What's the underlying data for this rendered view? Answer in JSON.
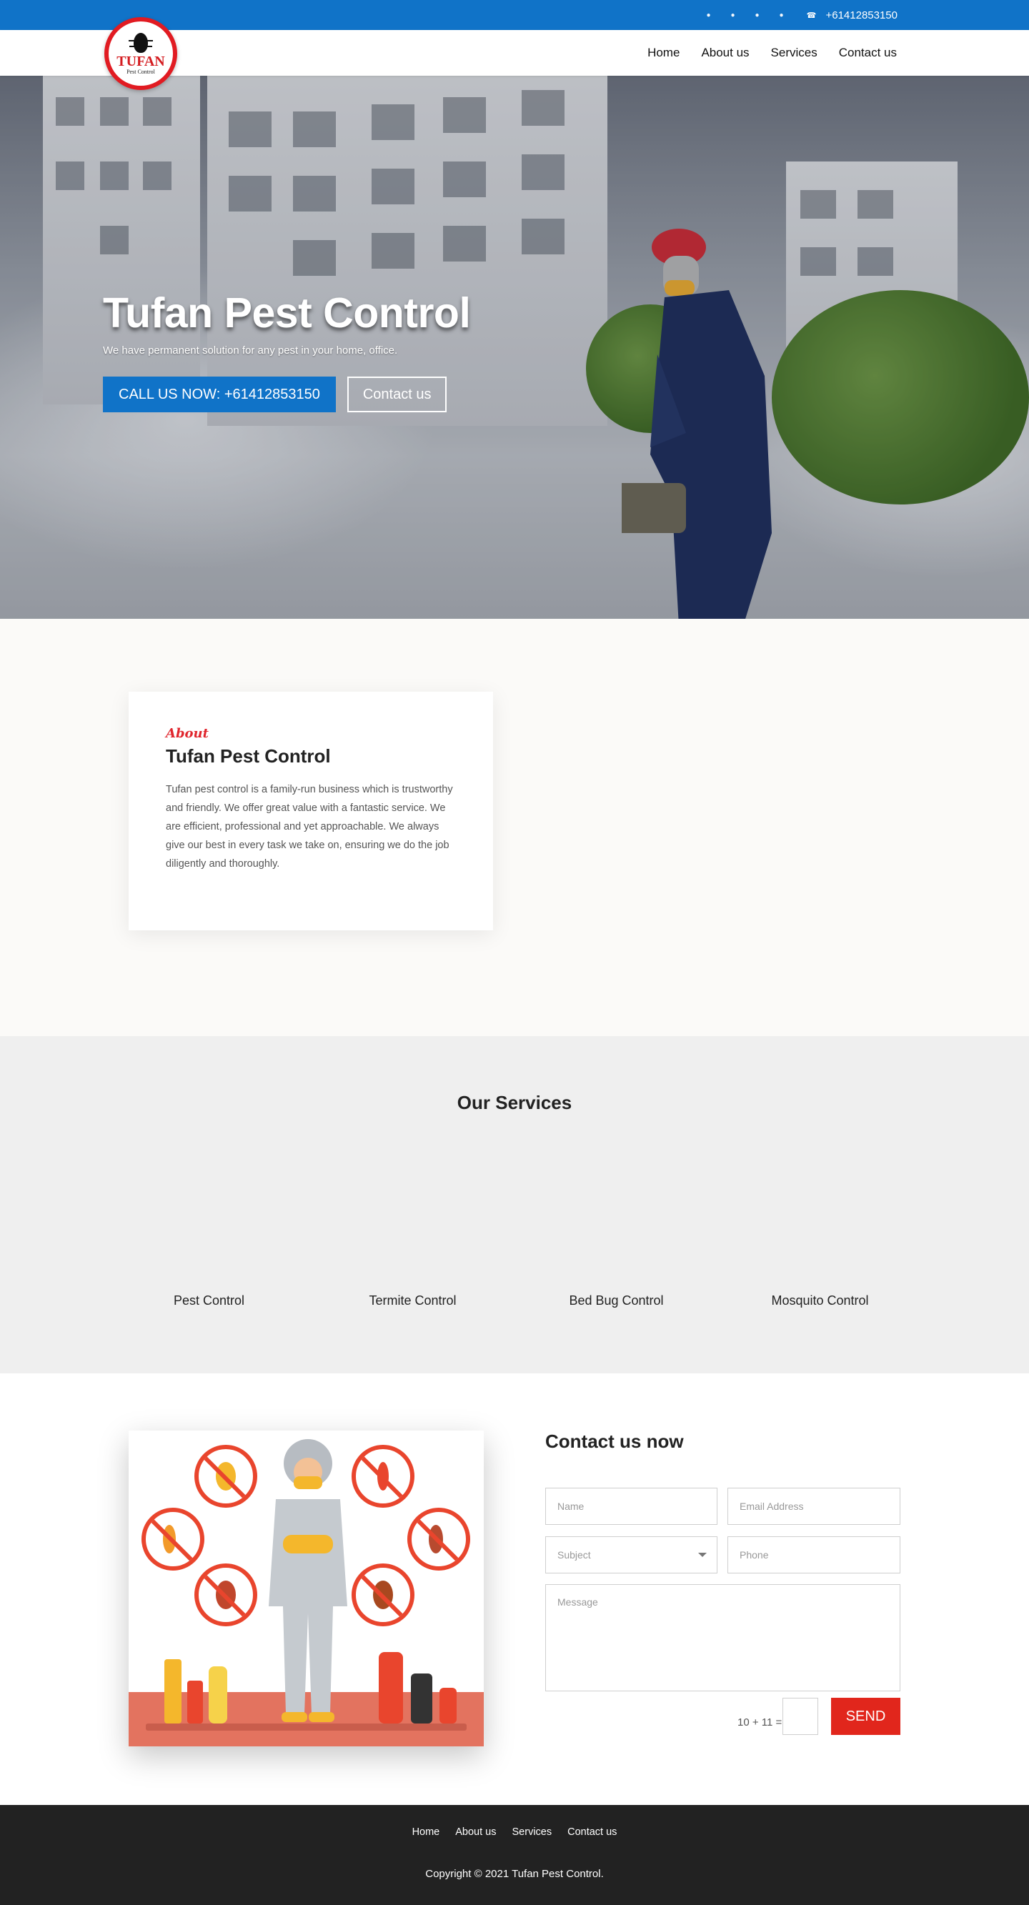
{
  "topbar": {
    "social_icons": [
      "facebook-icon",
      "twitter-icon",
      "linkedin-icon",
      "youtube-icon"
    ],
    "phone_icon": "phone-icon",
    "phone": "+61412853150",
    "bg_color": "#1073c8"
  },
  "header": {
    "logo_word": "TUFAN",
    "logo_sub": "Pest Control",
    "nav": [
      "Home",
      "About us",
      "Services",
      "Contact us"
    ]
  },
  "hero": {
    "title": "Tufan Pest Control",
    "subtitle": "We have permanent solution for any pest in your home, office.",
    "call_button": "CALL US NOW: +61412853150",
    "contact_button": "Contact us"
  },
  "about": {
    "script_label": "About",
    "title": "Tufan Pest Control",
    "text": "Tufan pest control is a family-run business which is trustworthy and friendly. We offer great value with a fantastic service. We are efficient, professional and yet approachable. We always give our best in every task we take on, ensuring we do the job diligently and thoroughly."
  },
  "services": {
    "title": "Our Services",
    "items": [
      "Pest Control",
      "Termite Control",
      "Bed Bug Control",
      "Mosquito Control"
    ]
  },
  "contact": {
    "title": "Contact us now",
    "name_placeholder": "Name",
    "email_placeholder": "Email Address",
    "subject_placeholder": "Subject",
    "phone_placeholder": "Phone",
    "message_placeholder": "Message",
    "captcha": "10 + 11 =",
    "send": "SEND"
  },
  "footer": {
    "nav": [
      "Home",
      "About us",
      "Services",
      "Contact us"
    ],
    "copyright": "Copyright © 2021 Tufan Pest Control."
  },
  "colors": {
    "primary_blue": "#1073c8",
    "accent_red": "#e1261c",
    "footer_bg": "#222222"
  }
}
